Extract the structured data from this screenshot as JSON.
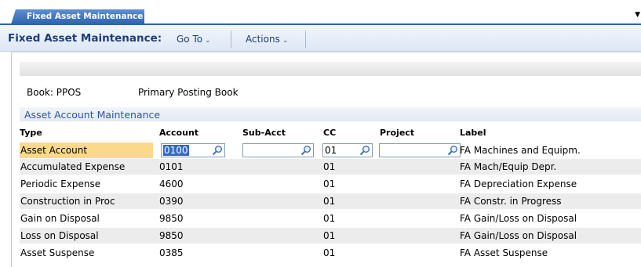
{
  "tab": {
    "label": "Fixed Asset Maintenance"
  },
  "toolbar": {
    "title": "Fixed Asset Maintenance:",
    "goto_label": "Go To",
    "actions_label": "Actions"
  },
  "book": {
    "label": "Book: PPOS",
    "value": "Primary Posting Book"
  },
  "section": {
    "title": "Asset Account Maintenance"
  },
  "table": {
    "headers": {
      "type": "Type",
      "account": "Account",
      "subacct": "Sub-Acct",
      "cc": "CC",
      "project": "Project",
      "label": "Label"
    },
    "rows": [
      {
        "type": "Asset Account",
        "account": "0100",
        "subacct": "",
        "cc": "01",
        "project": "",
        "label": "FA Machines and Equipm."
      },
      {
        "type": "Accumulated Expense",
        "account": "0101",
        "subacct": "",
        "cc": "01",
        "project": "",
        "label": "FA Mach/Equip Depr."
      },
      {
        "type": "Periodic Expense",
        "account": "4600",
        "subacct": "",
        "cc": "01",
        "project": "",
        "label": "FA Depreciation Expense"
      },
      {
        "type": "Construction in Proc",
        "account": "0390",
        "subacct": "",
        "cc": "01",
        "project": "",
        "label": "FA Constr. in Progress"
      },
      {
        "type": "Gain on Disposal",
        "account": "9850",
        "subacct": "",
        "cc": "01",
        "project": "",
        "label": "FA Gain/Loss on Disposal"
      },
      {
        "type": "Loss on Disposal",
        "account": "9850",
        "subacct": "",
        "cc": "01",
        "project": "",
        "label": "FA Gain/Loss on Disposal"
      },
      {
        "type": "Asset Suspense",
        "account": "0385",
        "subacct": "",
        "cc": "01",
        "project": "",
        "label": "FA Asset Suspense"
      }
    ]
  },
  "colors": {
    "accent": "#2f62b0",
    "header_text": "#1f3d7a",
    "highlight": "#fbd98b",
    "alt_row": "#ececec"
  }
}
